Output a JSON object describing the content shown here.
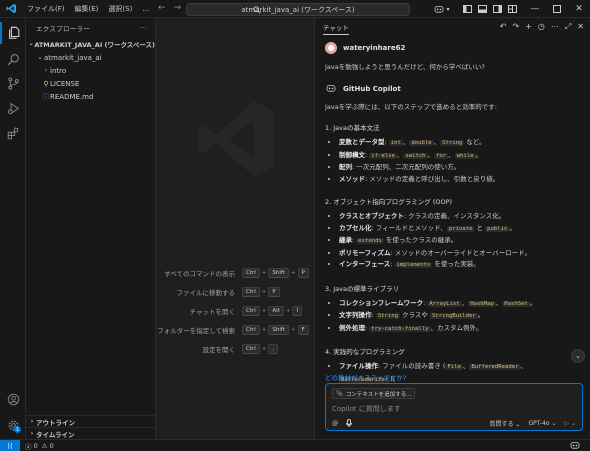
{
  "titlebar": {
    "menus": [
      "ファイル(F)",
      "編集(E)",
      "選択(S)",
      "…"
    ],
    "command_center": "atmarkit_java_ai (ワークスペース)"
  },
  "explorer": {
    "title": "エクスプローラー",
    "more": "···",
    "workspace": "ATMARKIT_JAVA_AI (ワークスペース)",
    "folder": "atmarkit_java_ai",
    "items": [
      "intro",
      "LICENSE",
      "README.md"
    ],
    "outline": "アウトライン",
    "timeline": "タイムライン"
  },
  "editor": {
    "shortcuts": [
      {
        "label": "すべてのコマンドの表示",
        "keys": [
          "Ctrl",
          "Shift",
          "P"
        ]
      },
      {
        "label": "ファイルに移動する",
        "keys": [
          "Ctrl",
          "P"
        ]
      },
      {
        "label": "チャットを開く",
        "keys": [
          "Ctrl",
          "Alt",
          "I"
        ]
      },
      {
        "label": "フォルダーを指定して検索",
        "keys": [
          "Ctrl",
          "Shift",
          "F"
        ]
      },
      {
        "label": "設定を開く",
        "keys": [
          "Ctrl",
          ","
        ]
      }
    ]
  },
  "chat": {
    "title": "チャット",
    "user_name": "wateryinhare62",
    "question": "Javaを勉強しようと思うんだけど、何から学べばいい?",
    "copilot_name": "GitHub Copilot",
    "intro": "Javaを学ぶ際には、以下のステップで進めると効率的です:",
    "sections": [
      {
        "title": "1. Javaの基本文法"
      },
      {
        "title": "2. オブジェクト指向プログラミング (OOP)"
      },
      {
        "title": "3. Javaの標準ライブラリ"
      },
      {
        "title": "4. 実践的なプログラミング"
      }
    ],
    "suggestion": "どの教材がオススメですか?",
    "attach_label": "コンテキストを追加する...",
    "placeholder": "Copilot に質問します",
    "mode": "質問する",
    "model": "GPT-4o"
  },
  "status": {
    "errors": "0",
    "warnings": "0"
  },
  "colors": {
    "accent": "#0078d4",
    "code": "#d7ba7d",
    "link": "#3794ff"
  }
}
